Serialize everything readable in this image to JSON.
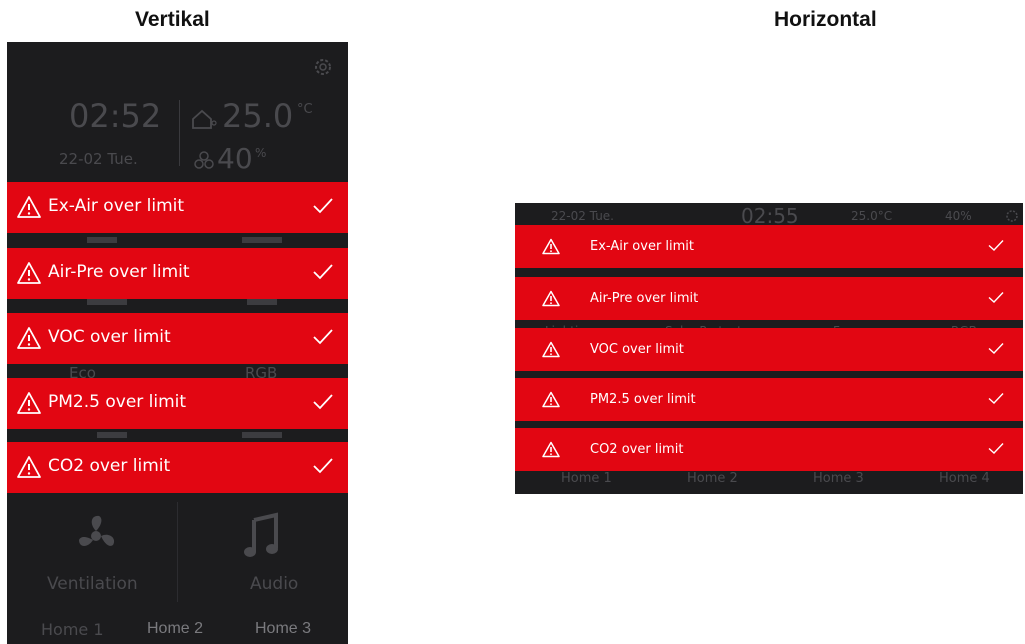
{
  "headings": {
    "vertical": "Vertikal",
    "horizontal": "Horizontal"
  },
  "colors": {
    "alert_red": "#e20612",
    "panel_bg": "#1c1c1e",
    "text_white": "#ffffff"
  },
  "vertical": {
    "time": "02:52",
    "date": "22-02 Tue.",
    "temperature": "25.0",
    "temperature_unit": "°C",
    "humidity": "40",
    "humidity_unit": "%",
    "tiles": {
      "eco": "Eco",
      "rgb": "RGB",
      "ventilation": "Ventilation",
      "audio": "Audio"
    },
    "tabs": [
      "Home 1",
      "Home 2",
      "Home 3"
    ],
    "alerts": [
      {
        "label": "Ex-Air over limit",
        "icon": "warning-icon",
        "action_icon": "check-icon"
      },
      {
        "label": "Air-Pre over limit",
        "icon": "warning-icon",
        "action_icon": "check-icon"
      },
      {
        "label": "VOC over limit",
        "icon": "warning-icon",
        "action_icon": "check-icon"
      },
      {
        "label": "PM2.5 over limit",
        "icon": "warning-icon",
        "action_icon": "check-icon"
      },
      {
        "label": "CO2 over limit",
        "icon": "warning-icon",
        "action_icon": "check-icon"
      }
    ]
  },
  "horizontal": {
    "date": "22-02 Tue.",
    "time": "02:55",
    "temperature": "25.0°C",
    "humidity": "40%",
    "tiles": [
      "Lighting",
      "Solar Protect",
      "Fan",
      "RGB"
    ],
    "tabs": [
      "Home 1",
      "Home 2",
      "Home 3",
      "Home 4"
    ],
    "alerts": [
      {
        "label": "Ex-Air over limit",
        "icon": "warning-icon",
        "action_icon": "check-icon"
      },
      {
        "label": "Air-Pre over limit",
        "icon": "warning-icon",
        "action_icon": "check-icon"
      },
      {
        "label": "VOC over limit",
        "icon": "warning-icon",
        "action_icon": "check-icon"
      },
      {
        "label": "PM2.5 over limit",
        "icon": "warning-icon",
        "action_icon": "check-icon"
      },
      {
        "label": "CO2 over limit",
        "icon": "warning-icon",
        "action_icon": "check-icon"
      }
    ]
  }
}
